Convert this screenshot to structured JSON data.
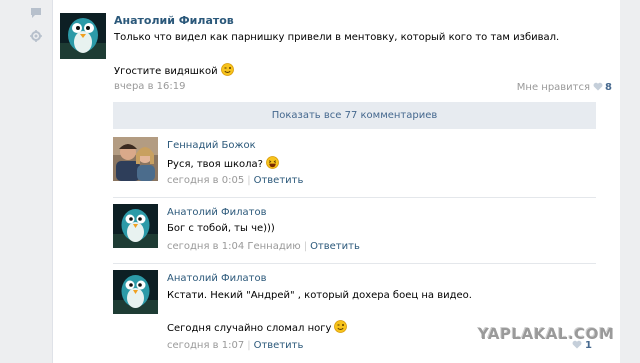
{
  "post": {
    "author": "Анатолий Филатов",
    "text_line1": "Только что видел как парнишку привели в ментовку, который кого то там избивал.",
    "text_line2": "Угостите видяшкой",
    "time": "вчера в 16:19",
    "likes_label": "Мне нравится",
    "likes_count": "8"
  },
  "show_all": "Показать все 77 комментариев",
  "comments": [
    {
      "author": "Геннадий Божок",
      "text": "Руся, твоя школа?",
      "time": "сегодня в 0:05",
      "reply_label": "Ответить"
    },
    {
      "author": "Анатолий Филатов",
      "text": "Бог с тобой, ты че)))",
      "time": "сегодня в 1:04",
      "reply_to": "Геннадию",
      "reply_label": "Ответить"
    },
    {
      "author": "Анатолий Филатов",
      "text_line1": "Кстати. Некий \"Андрей\" , который дохера боец на видео.",
      "text_line2": "Сегодня случайно сломал ногу",
      "time": "сегодня в 1:07",
      "reply_label": "Ответить"
    }
  ],
  "watermark": "YAPLAKAL.COM",
  "watermark_likes": "1",
  "colors": {
    "link": "#2b587a",
    "meta": "#999999",
    "show_all_bg": "#e7ebf0"
  }
}
